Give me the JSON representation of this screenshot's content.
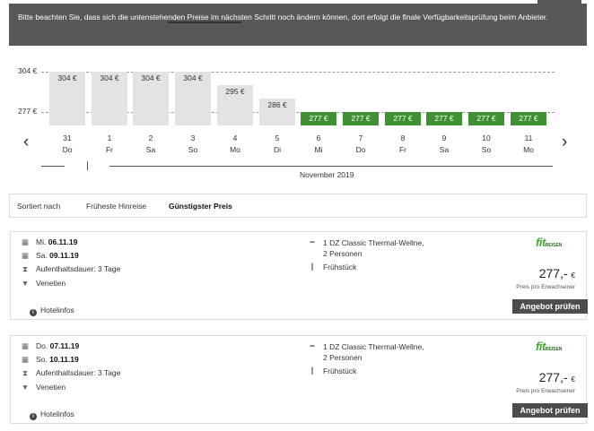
{
  "notice": "Bitte beachten Sie, dass sich die untenstehenden Preise im nächsten Schritt noch ändern können, dort erfolgt die finale Verfügbarkeitsprüfung beim Anbieter.",
  "chart_data": {
    "type": "bar",
    "ylabels": [
      "304 €",
      "277 €"
    ],
    "ylim": [
      277,
      304
    ],
    "categories": [
      "31 Do",
      "1 Fr",
      "2 Sa",
      "3 So",
      "4 Mo",
      "5 Di",
      "6 Mi",
      "7 Do",
      "8 Fr",
      "9 Sa",
      "10 So",
      "11 Mo"
    ],
    "values": [
      304,
      304,
      304,
      304,
      295,
      286,
      277,
      277,
      277,
      277,
      277,
      277
    ],
    "value_labels": [
      "304 €",
      "304 €",
      "304 €",
      "304 €",
      "295 €",
      "286 €",
      "277 €",
      "277 €",
      "277 €",
      "277 €",
      "277 €",
      "277 €"
    ],
    "days": [
      {
        "num": "31",
        "wd": "Do"
      },
      {
        "num": "1",
        "wd": "Fr"
      },
      {
        "num": "2",
        "wd": "Sa"
      },
      {
        "num": "3",
        "wd": "So"
      },
      {
        "num": "4",
        "wd": "Mo"
      },
      {
        "num": "5",
        "wd": "Di"
      },
      {
        "num": "6",
        "wd": "Mi"
      },
      {
        "num": "7",
        "wd": "Do"
      },
      {
        "num": "8",
        "wd": "Fr"
      },
      {
        "num": "9",
        "wd": "Sa"
      },
      {
        "num": "10",
        "wd": "So"
      },
      {
        "num": "11",
        "wd": "Mo"
      }
    ],
    "cheapest_color": "#3f9133",
    "default_color": "#e3e3e3"
  },
  "month_label": "November 2019",
  "nav": {
    "prev_icon": "chevron-left-icon",
    "next_icon": "chevron-right-icon"
  },
  "sort": {
    "label": "Sortiert nach",
    "tabs": [
      {
        "label": "Früheste Hinreise",
        "active": false
      },
      {
        "label": "Günstigster Preis",
        "active": true
      }
    ]
  },
  "offers": [
    {
      "depart_wd": "Mi.",
      "depart_date": "06.11.19",
      "return_wd": "Sa.",
      "return_date": "09.11.19",
      "stay": "Aufenthaltsdauer: 3 Tage",
      "destination": "Venetien",
      "room_line1": "1 DZ Classic Thermal-Wellne,",
      "room_line2": "2 Personen",
      "board": "Frühstück",
      "provider_logo": "fit",
      "provider_logo_sub": "REISEN",
      "price": "277,-",
      "currency": "€",
      "price_note": "Preis pro Erwachsener",
      "button": "Angebot prüfen",
      "hotel_info": "Hotelinfos"
    },
    {
      "depart_wd": "Do.",
      "depart_date": "07.11.19",
      "return_wd": "So.",
      "return_date": "10.11.19",
      "stay": "Aufenthaltsdauer: 3 Tage",
      "destination": "Venetien",
      "room_line1": "1 DZ Classic Thermal-Wellne,",
      "room_line2": "2 Personen",
      "board": "Frühstück",
      "provider_logo": "fit",
      "provider_logo_sub": "REISEN",
      "price": "277,-",
      "currency": "€",
      "price_note": "Preis pro Erwachsener",
      "button": "Angebot prüfen",
      "hotel_info": "Hotelinfos"
    }
  ]
}
